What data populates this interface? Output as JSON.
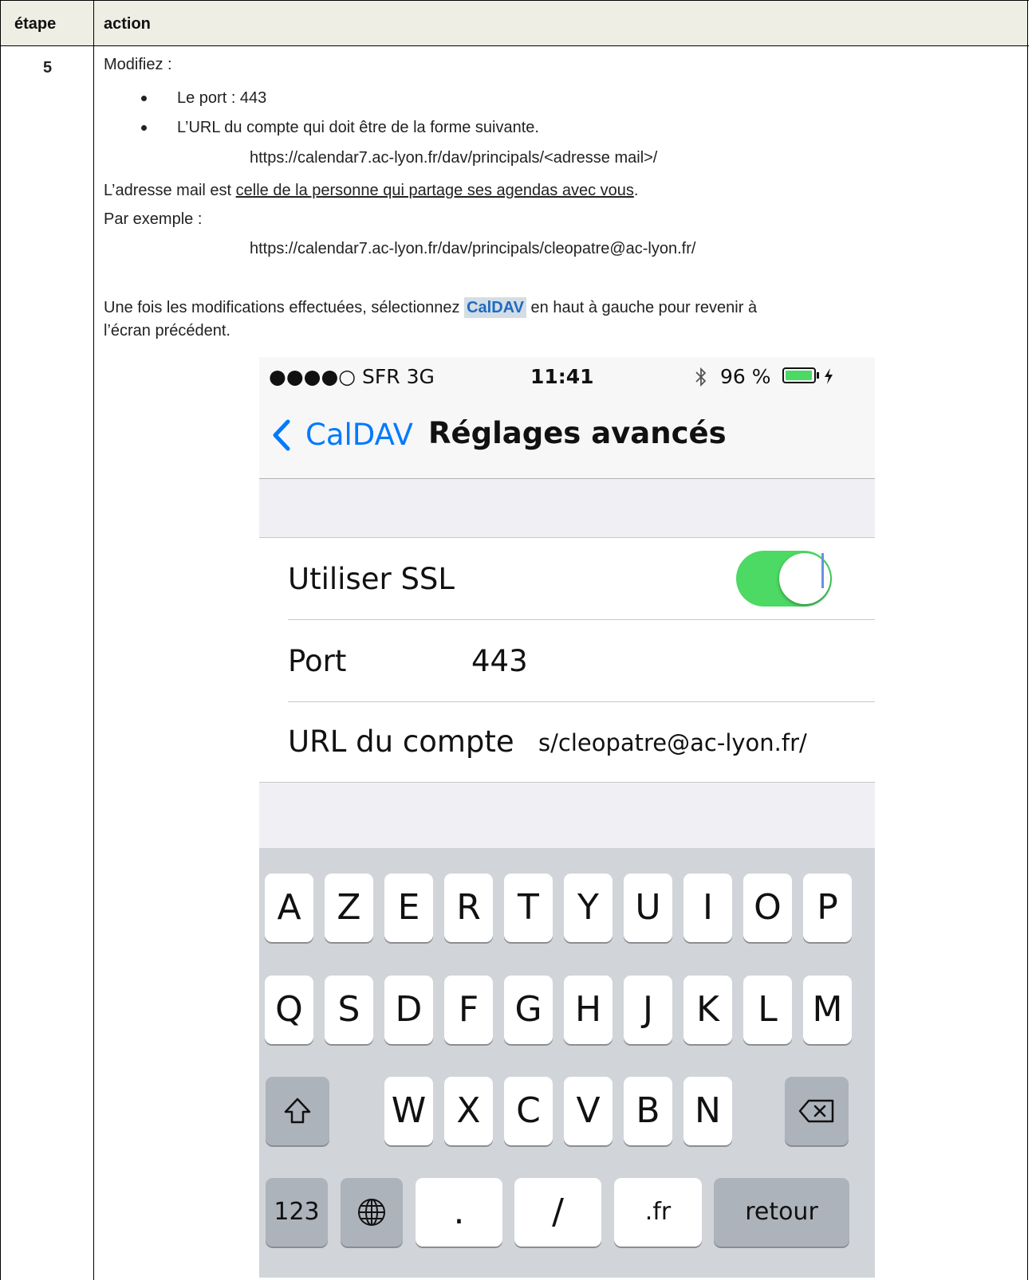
{
  "table": {
    "header_step": "étape",
    "header_action": "action",
    "step_number": "5"
  },
  "instructions": {
    "modifiez": "Modifiez :",
    "bullets": [
      "Le port : 443",
      "L’URL du compte qui doit être de la forme suivante."
    ],
    "url_template": "https://calendar7.ac-lyon.fr/dav/principals/<adresse mail>/",
    "mail_note_prefix": "L’adresse mail est ",
    "mail_note_underlined": "celle de la personne qui partage ses agendas avec vous",
    "mail_note_suffix": ".",
    "example_label": "Par exemple :",
    "example_url": "https://calendar7.ac-lyon.fr/dav/principals/cleopatre@ac-lyon.fr/",
    "final_prefix": "Une fois les modifications effectuées, sélectionnez ",
    "final_highlight": "CalDAV",
    "final_suffix": " en haut à gauche pour revenir à",
    "final_line2": "l’écran précédent."
  },
  "phone": {
    "status": {
      "carrier": "●●●●○ SFR  3G",
      "time": "11:41",
      "battery_percent": "96 %",
      "battery_level": 0.96
    },
    "nav": {
      "back_label": "CalDAV",
      "title": "Réglages avancés"
    },
    "settings": {
      "ssl_label": "Utiliser SSL",
      "ssl_on": true,
      "port_label": "Port",
      "port_value": "443",
      "url_label": "URL du compte",
      "url_value": "s/cleopatre@ac-lyon.fr/"
    },
    "keyboard": {
      "row1": [
        "A",
        "Z",
        "E",
        "R",
        "T",
        "Y",
        "U",
        "I",
        "O",
        "P"
      ],
      "row2": [
        "Q",
        "S",
        "D",
        "F",
        "G",
        "H",
        "J",
        "K",
        "L",
        "M"
      ],
      "row3": [
        "W",
        "X",
        "C",
        "V",
        "B",
        "N"
      ],
      "row4": {
        "num": "123",
        "dot": ".",
        "slash": "/",
        "fr": ".fr",
        "return": "retour"
      }
    }
  },
  "colors": {
    "ios_blue": "#007aff",
    "toggle_green": "#4cd964",
    "header_bg": "#eeeee5"
  }
}
